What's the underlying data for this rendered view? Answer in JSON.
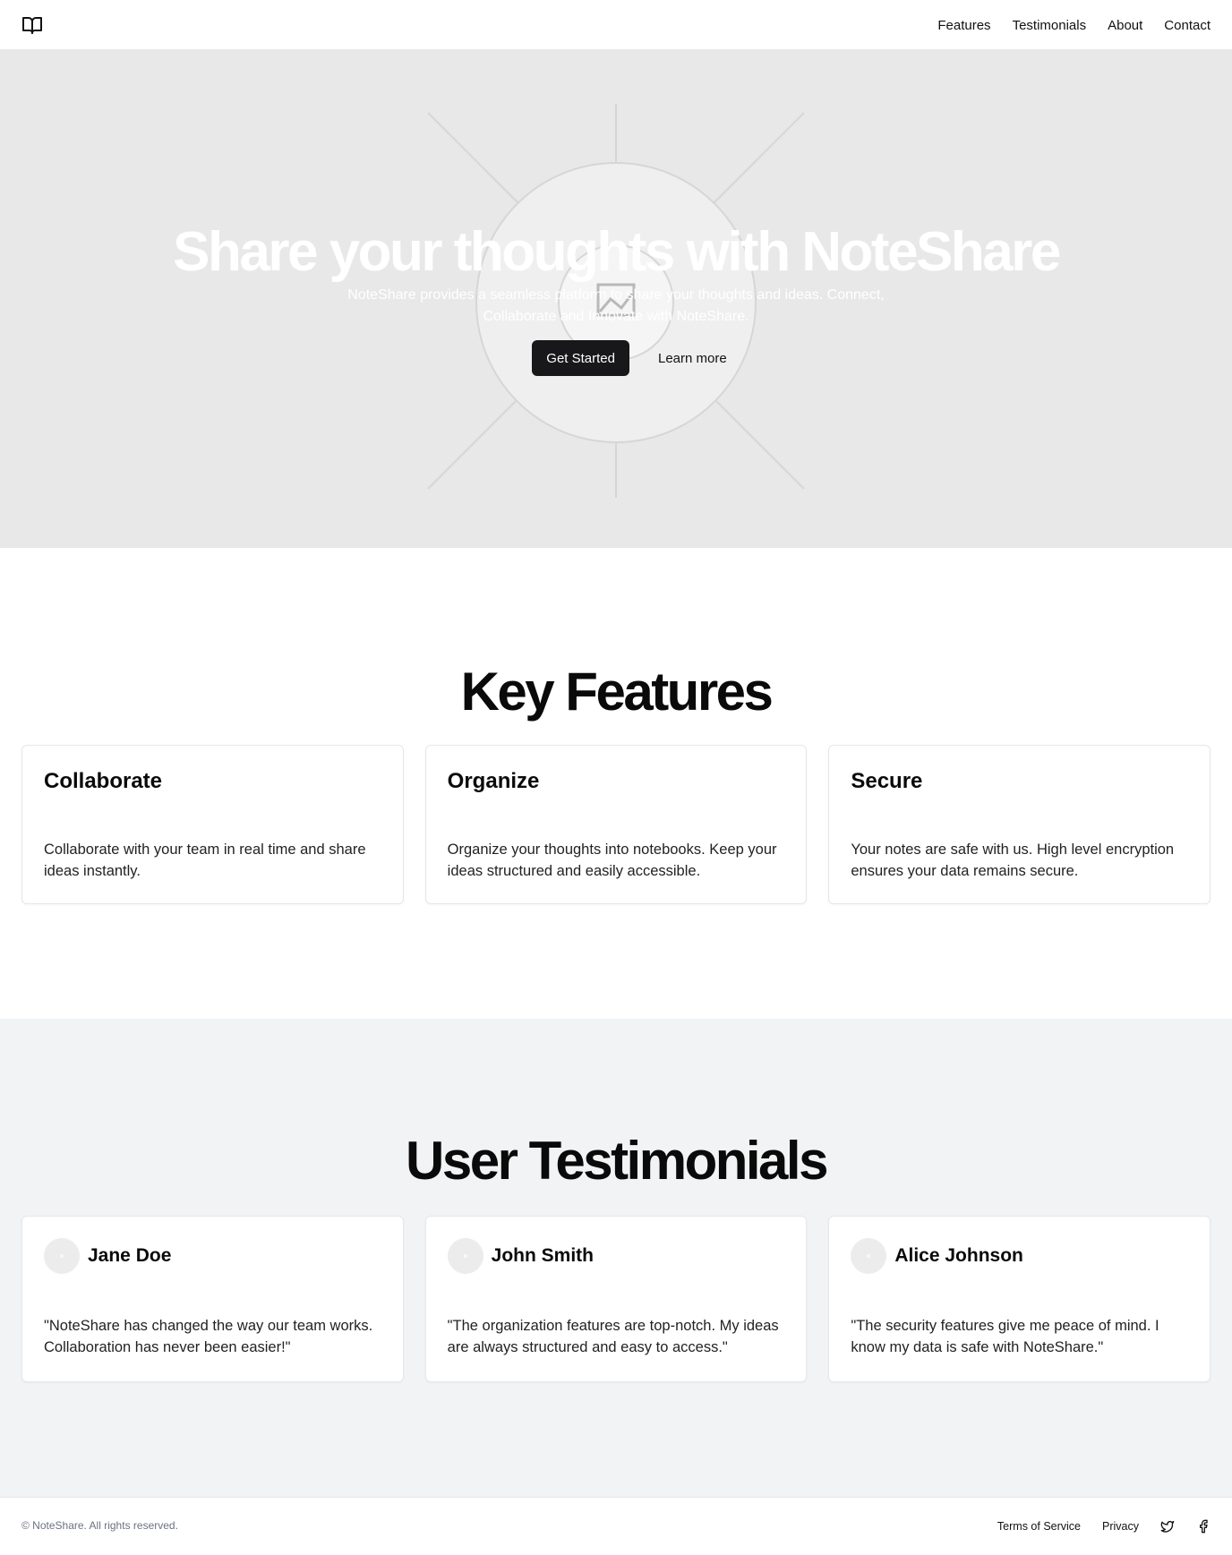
{
  "header": {
    "logo_icon": "book-open-icon",
    "nav": [
      {
        "label": "Features"
      },
      {
        "label": "Testimonials"
      },
      {
        "label": "About"
      },
      {
        "label": "Contact"
      }
    ]
  },
  "hero": {
    "title": "Share your thoughts with NoteShare",
    "subtitle": "NoteShare provides a seamless platform to share your thoughts and ideas. Connect, Collaborate and Innovate with NoteShare.",
    "primary_button": "Get Started",
    "secondary_link": "Learn more",
    "background_icon": "image-placeholder-icon"
  },
  "features": {
    "title": "Key Features",
    "items": [
      {
        "title": "Collaborate",
        "text": "Collaborate with your team in real time and share ideas instantly."
      },
      {
        "title": "Organize",
        "text": "Organize your thoughts into notebooks. Keep your ideas structured and easily accessible."
      },
      {
        "title": "Secure",
        "text": "Your notes are safe with us. High level encryption ensures your data remains secure."
      }
    ]
  },
  "testimonials": {
    "title": "User Testimonials",
    "items": [
      {
        "name": "Jane Doe",
        "quote": "\"NoteShare has changed the way our team works. Collaboration has never been easier!\""
      },
      {
        "name": "John Smith",
        "quote": "\"The organization features are top-notch. My ideas are always structured and easy to access.\""
      },
      {
        "name": "Alice Johnson",
        "quote": "\"The security features give me peace of mind. I know my data is safe with NoteShare.\""
      }
    ]
  },
  "footer": {
    "copyright": "© NoteShare. All rights reserved.",
    "links": [
      {
        "label": "Terms of Service"
      },
      {
        "label": "Privacy"
      }
    ],
    "social_icons": [
      "twitter-icon",
      "facebook-icon"
    ]
  },
  "colors": {
    "primary_button": "#18181b",
    "hero_background": "#e8e8e8",
    "testimonials_background": "#f2f3f5"
  }
}
